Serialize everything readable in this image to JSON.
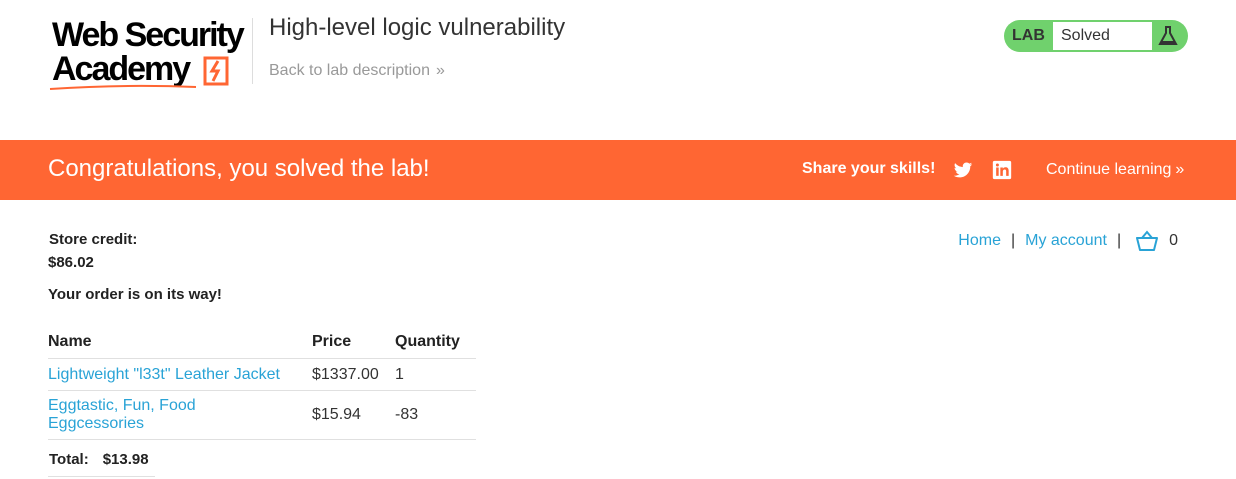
{
  "header": {
    "logo_line1": "Web Security",
    "logo_line2": "Academy",
    "lab_title": "High-level logic vulnerability",
    "back_link": "Back to lab description",
    "lab_tag": "LAB",
    "lab_status": "Solved",
    "status_color": "#70d16d"
  },
  "banner": {
    "message": "Congratulations, you solved the lab!",
    "share": "Share your skills!",
    "continue": "Continue learning",
    "color": "#ff6633"
  },
  "nav": {
    "home": "Home",
    "account": "My account",
    "separator": "|",
    "cart_count": "0",
    "link_color": "#29a3d6"
  },
  "account": {
    "credit_label": "Store credit:",
    "credit_value": "$86.02",
    "order_message": "Your order is on its way!"
  },
  "order": {
    "columns": [
      "Name",
      "Price",
      "Quantity"
    ],
    "rows": [
      {
        "name": "Lightweight \"l33t\" Leather Jacket",
        "price": "$1337.00",
        "quantity": "1"
      },
      {
        "name": "Eggtastic, Fun, Food Eggcessories",
        "price": "$15.94",
        "quantity": "-83"
      }
    ],
    "total_label": "Total:",
    "total_value": "$13.98"
  },
  "icons": [
    "bolt-icon",
    "flask-icon",
    "twitter-icon",
    "linkedin-icon",
    "cart-icon",
    "chevron-right-icon"
  ]
}
